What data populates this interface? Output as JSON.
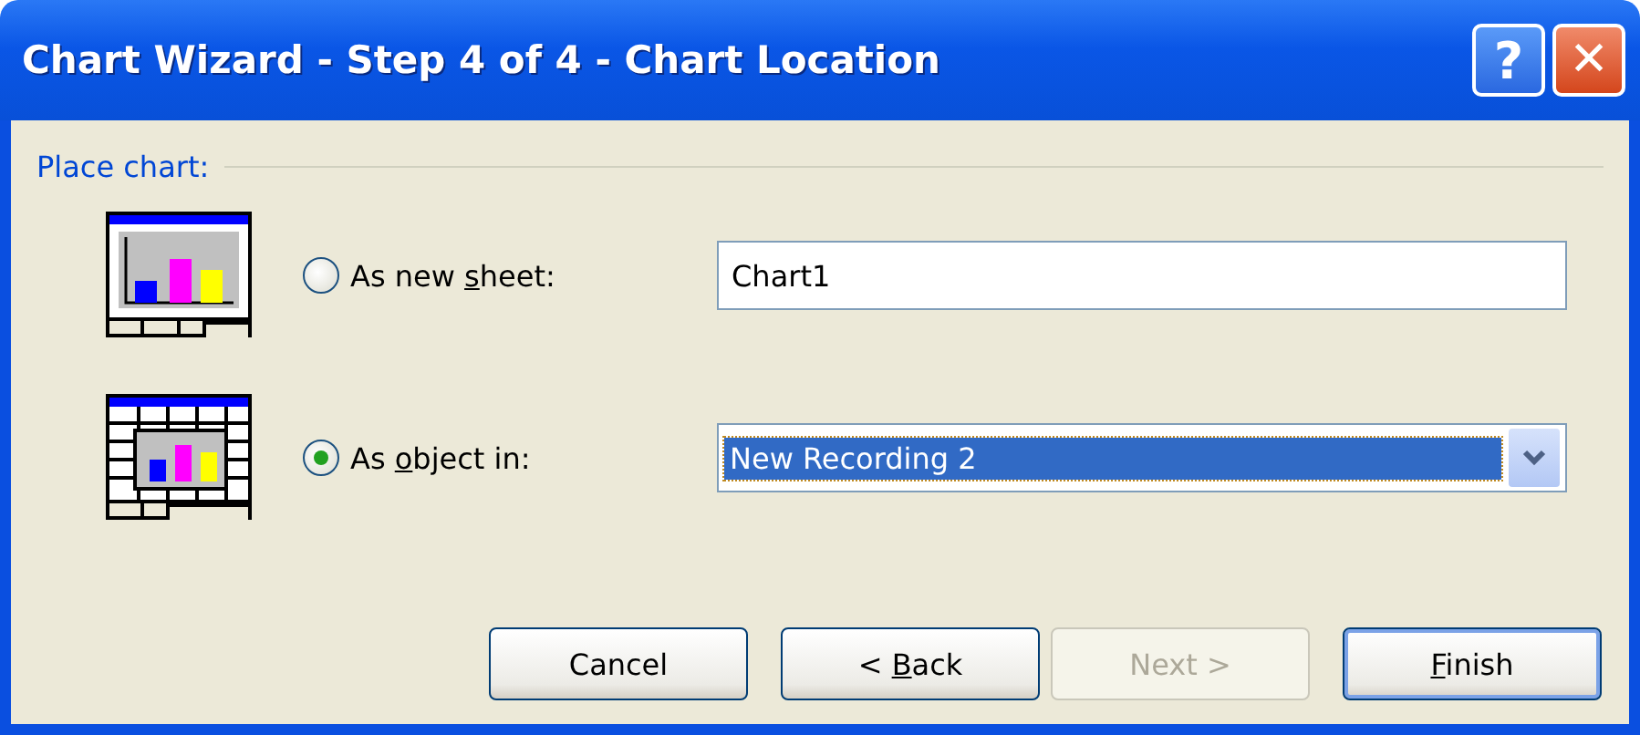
{
  "window": {
    "title": "Chart Wizard - Step 4 of 4 - Chart Location",
    "controls": [
      {
        "kind": "help",
        "label": "?"
      },
      {
        "kind": "close",
        "label": "✕"
      }
    ]
  },
  "group": {
    "label": "Place chart:"
  },
  "options": [
    {
      "kind": "sheet",
      "label": {
        "before": "As new ",
        "key": "s",
        "after": "heet:"
      },
      "selected": false,
      "field": {
        "kind": "text",
        "value": "Chart1",
        "focused": false
      }
    },
    {
      "kind": "object",
      "label": {
        "before": "As ",
        "key": "o",
        "after": "bject in:"
      },
      "selected": true,
      "field": {
        "kind": "combo",
        "value": "New Recording 2",
        "focused": true
      }
    }
  ],
  "buttons": [
    {
      "label": {
        "before": "Cancel"
      },
      "disabled": false,
      "default": false
    },
    {
      "label": {
        "before": "< ",
        "key": "B",
        "after": "ack"
      },
      "disabled": false,
      "default": false
    },
    {
      "label": {
        "before": "Next >"
      },
      "disabled": true,
      "default": false
    },
    {
      "label": {
        "key": "F",
        "after": "inish"
      },
      "disabled": false,
      "default": true
    }
  ]
}
